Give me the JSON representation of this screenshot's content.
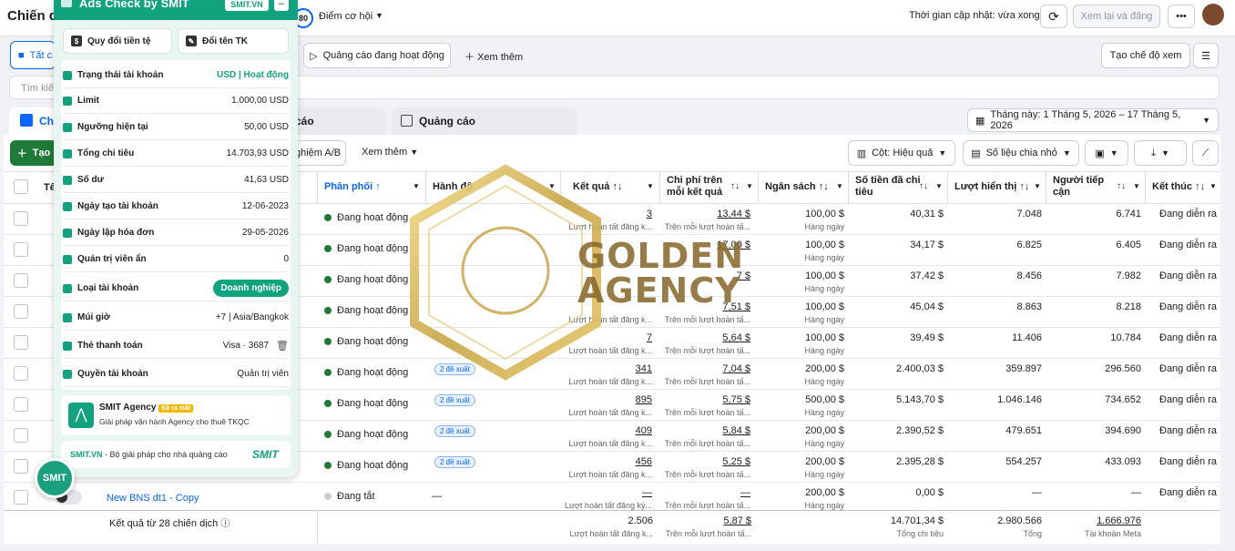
{
  "topbar": {
    "title": "Chiến dị",
    "opportunity_score": "80",
    "opportunity_label": "Điểm cơ hội",
    "update_time": "Thời gian cập nhật: vừa xong",
    "review_button": "Xem lại và đăng"
  },
  "toolbar": {
    "all_tab": "Tất c",
    "active_ads": "Quảng cáo đang hoạt động",
    "see_more": "Xem thêm",
    "create_view": "Tạo chế độ xem",
    "search_placeholder": "Tìm kiế"
  },
  "level_tabs": {
    "campaigns": "Ch",
    "adsets": "cáo",
    "ads": "Quảng cáo"
  },
  "date_range": "Tháng này: 1 Tháng 5, 2026 – 17 Tháng 5, 2026",
  "actions": {
    "create": "Tạo",
    "ab_test": "nghiệm A/B",
    "see_more": "Xem thêm",
    "columns": "Cột: Hiệu quả",
    "breakdown": "Số liệu chia nhỏ"
  },
  "columns": {
    "name": "Tê",
    "delivery": "Phân phối ↑",
    "actions": "Hành độ",
    "results": "Kết quả",
    "cost_per_result": "Chi phí trên mỗi kết quả",
    "budget": "Ngân sách",
    "amount_spent": "Số tiền đã chi tiêu",
    "impressions": "Lượt hiển thị",
    "reach": "Người tiếp cận",
    "ends": "Kết thúc"
  },
  "rows": [
    {
      "delivery": "Đang hoạt động",
      "suggest": "",
      "results": "3",
      "results_sub": "Lượt hoàn tất đăng k...",
      "cpr": "13,44 $",
      "cpr_sub": "Trên mỗi lượt hoàn tấ...",
      "budget": "100,00 $",
      "budget_sub": "Hàng ngày",
      "spent": "40,31 $",
      "impressions": "7.048",
      "reach": "6.741",
      "ends": "Đang diễn ra"
    },
    {
      "delivery": "Đang hoạt động",
      "suggest": "",
      "results": "",
      "results_sub": "",
      "cpr": "17,00 $",
      "cpr_sub": "",
      "budget": "100,00 $",
      "budget_sub": "Hàng ngày",
      "spent": "34,17 $",
      "impressions": "6.825",
      "reach": "6.405",
      "ends": "Đang diễn ra"
    },
    {
      "delivery": "Đang hoạt động",
      "suggest": "",
      "results": "",
      "results_sub": "",
      "cpr": "7 $",
      "cpr_sub": "",
      "budget": "100,00 $",
      "budget_sub": "Hàng ngày",
      "spent": "37,42 $",
      "impressions": "8.456",
      "reach": "7.982",
      "ends": "Đang diễn ra"
    },
    {
      "delivery": "Đang hoạt động",
      "suggest": "",
      "results": "",
      "results_sub": "Lượt hoàn tất đăng k...",
      "cpr": "7,51 $",
      "cpr_sub": "Trên mỗi lượt hoàn tấ...",
      "budget": "100,00 $",
      "budget_sub": "Hàng ngày",
      "spent": "45,04 $",
      "impressions": "8.863",
      "reach": "8.218",
      "ends": "Đang diễn ra"
    },
    {
      "delivery": "Đang hoạt động",
      "suggest": "",
      "results": "7",
      "results_sub": "Lượt hoàn tất đăng k...",
      "cpr": "5,64 $",
      "cpr_sub": "Trên mỗi lượt hoàn tấ...",
      "budget": "100,00 $",
      "budget_sub": "Hàng ngày",
      "spent": "39,49 $",
      "impressions": "11.406",
      "reach": "10.784",
      "ends": "Đang diễn ra"
    },
    {
      "delivery": "Đang hoạt động",
      "suggest": "2 đề xuất",
      "results": "341",
      "results_sub": "Lượt hoàn tất đăng k...",
      "cpr": "7,04 $",
      "cpr_sub": "Trên mỗi lượt hoàn tấ...",
      "budget": "200,00 $",
      "budget_sub": "Hàng ngày",
      "spent": "2.400,03 $",
      "impressions": "359.897",
      "reach": "296.560",
      "ends": "Đang diễn ra"
    },
    {
      "delivery": "Đang hoạt động",
      "suggest": "2 đề xuất",
      "results": "895",
      "results_sub": "Lượt hoàn tất đăng k...",
      "cpr": "5,75 $",
      "cpr_sub": "Trên mỗi lượt hoàn tấ...",
      "budget": "500,00 $",
      "budget_sub": "Hàng ngày",
      "spent": "5.143,70 $",
      "impressions": "1.046.146",
      "reach": "734.652",
      "ends": "Đang diễn ra"
    },
    {
      "delivery": "Đang hoạt động",
      "suggest": "2 đề xuất",
      "results": "409",
      "results_sub": "Lượt hoàn tất đăng k...",
      "cpr": "5,84 $",
      "cpr_sub": "Trên mỗi lượt hoàn tấ...",
      "budget": "200,00 $",
      "budget_sub": "Hàng ngày",
      "spent": "2.390,52 $",
      "impressions": "479.651",
      "reach": "394.690",
      "ends": "Đang diễn ra"
    },
    {
      "delivery": "Đang hoạt động",
      "suggest": "2 đề xuất",
      "results": "456",
      "results_sub": "Lượt hoàn tất đăng k...",
      "cpr": "5,25 $",
      "cpr_sub": "Trên mỗi lượt hoàn tấ...",
      "budget": "200,00 $",
      "budget_sub": "Hàng ngày",
      "spent": "2.395,28 $",
      "impressions": "554.257",
      "reach": "433.093",
      "ends": "Đang diễn ra"
    },
    {
      "name": "New BNS dt1 - Copy",
      "delivery": "Đang tắt",
      "suggest": "—",
      "results": "—",
      "results_sub": "Lượt hoàn tất đăng ký...",
      "cpr": "—",
      "cpr_sub": "Trên mỗi lượt hoàn tấ...",
      "budget": "200,00 $",
      "budget_sub": "Hàng ngày",
      "spent": "0,00 $",
      "impressions": "—",
      "reach": "—",
      "ends": "Đang diễn ra"
    }
  ],
  "totals": {
    "label": "Kết quả từ 28 chiến dịch",
    "results": "2.506",
    "results_sub": "Lượt hoàn tất đăng k...",
    "cpr": "5,87 $",
    "cpr_sub": "Trên mỗi lượt hoàn tấ...",
    "spent": "14.701,34 $",
    "spent_sub": "Tổng chi tiêu",
    "impressions": "2.980.566",
    "impressions_sub": "Tổng",
    "reach": "1.666.976",
    "reach_sub": "Tài khoản Meta"
  },
  "extension": {
    "title": "Ads Check by SMIT",
    "badge": "SMIT.VN",
    "convert_currency": "Quy đổi tiền tệ",
    "rename": "Đổi tên TK",
    "items": [
      {
        "label": "Trạng thái tài khoản",
        "value": "USD | Hoạt động"
      },
      {
        "label": "Limit",
        "value": "1.000,00 USD"
      },
      {
        "label": "Ngưỡng hiện tại",
        "value": "50,00 USD"
      },
      {
        "label": "Tổng chi tiêu",
        "value": "14.703,93 USD"
      },
      {
        "label": "Số dư",
        "value": "41,63 USD"
      },
      {
        "label": "Ngày tạo tài khoản",
        "value": "12-06-2023"
      },
      {
        "label": "Ngày lập hóa đơn",
        "value": "29-05-2026"
      },
      {
        "label": "Quản trị viên ẩn",
        "value": "0"
      },
      {
        "label": "Loại tài khoản",
        "value": "Doanh nghiệp"
      },
      {
        "label": "Múi giờ",
        "value": "+7 | Asia/Bangkok"
      },
      {
        "label": "Thẻ thanh toán",
        "value": "Visa · 3687"
      },
      {
        "label": "Quyền tài khoản",
        "value": "Quản trị viên"
      }
    ],
    "promo_title": "SMIT Agency",
    "promo_tag": "Đã ra mắt",
    "promo_desc": "Giải pháp vận hành Agency cho thuê TKQC",
    "footer_brand": "SMIT.VN",
    "footer_text": " - Bộ giải pháp cho nhà quảng cáo",
    "footer_logo": "SMIT",
    "fab": "SMIT"
  },
  "watermark": {
    "line1": "GOLDEN",
    "line2": "AGENCY"
  },
  "colors": {
    "accent": "#0866ff",
    "green": "#11a27e",
    "gold": "#c9a64a",
    "brown": "#8a6a2e"
  }
}
